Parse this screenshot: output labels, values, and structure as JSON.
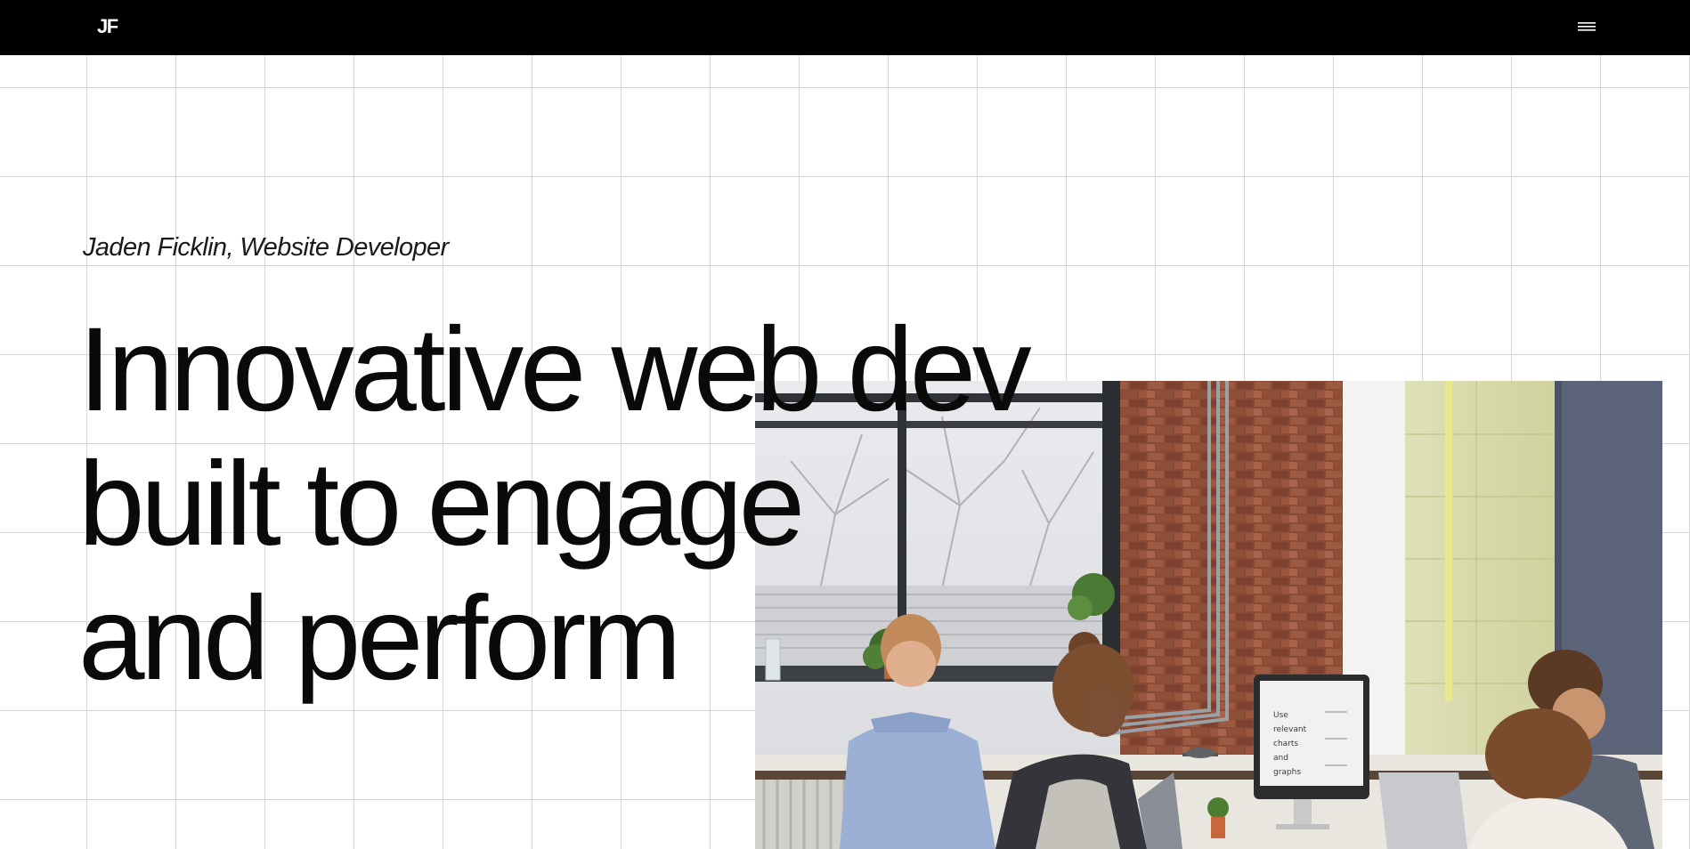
{
  "nav": {
    "logo_text": "JF",
    "menu_icon": "hamburger-menu-icon"
  },
  "hero": {
    "subtitle": "Jaden Ficklin, Website Developer",
    "headline_lines": [
      "Innovative web dev",
      "built to engage",
      "and perform"
    ],
    "photo_alt": "office-team-photo"
  },
  "photo_screen_text": [
    "Use",
    "relevant",
    "charts",
    "and",
    "graphs"
  ],
  "colors": {
    "topbar": "#000000",
    "background": "#ffffff",
    "grid_line": "#d6d6d6",
    "text": "#0a0a0a"
  }
}
